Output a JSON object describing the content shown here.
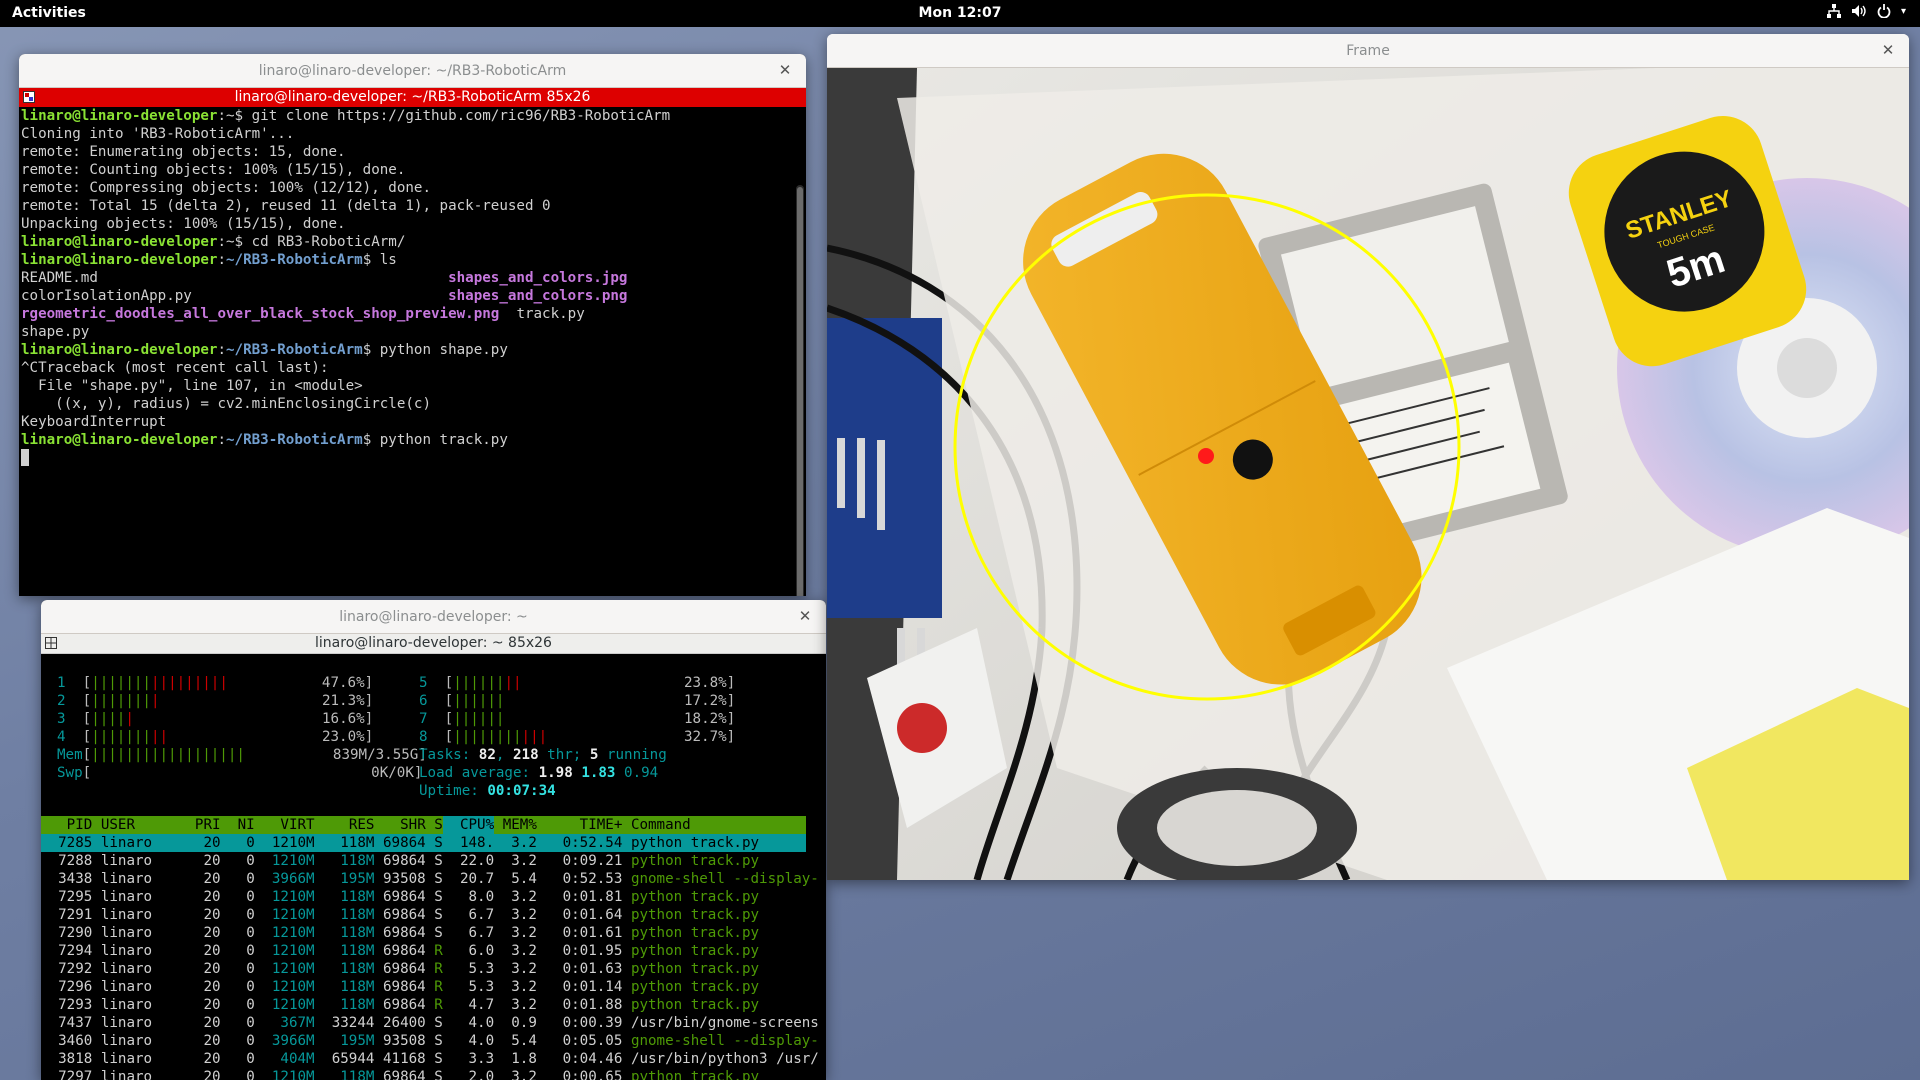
{
  "topbar": {
    "activities": "Activities",
    "clock": "Mon 12:07"
  },
  "terminal1": {
    "window_title": "linaro@linaro-developer: ~/RB3-RoboticArm",
    "tab_title": "linaro@linaro-developer: ~/RB3-RoboticArm 85x26",
    "prompt_user": "linaro@linaro-developer",
    "lines": {
      "l1_path": ":~$ ",
      "l1_cmd": "git clone https://github.com/ric96/RB3-RoboticArm",
      "l2": "Cloning into 'RB3-RoboticArm'...",
      "l3": "remote: Enumerating objects: 15, done.",
      "l4": "remote: Counting objects: 100% (15/15), done.",
      "l5": "remote: Compressing objects: 100% (12/12), done.",
      "l6": "remote: Total 15 (delta 2), reused 11 (delta 1), pack-reused 0",
      "l7": "Unpacking objects: 100% (15/15), done.",
      "l8_path": ":~$ ",
      "l8_cmd": "cd RB3-RoboticArm/",
      "l9_path": ":~/RB3-RoboticArm",
      "l9_cmd": "$ ls",
      "ls_col1": [
        "README.md",
        "colorIsolationApp.py",
        "rgeometric_doodles_all_over_black_stock_shop_preview.png",
        "shape.py"
      ],
      "ls_col2": [
        "shapes_and_colors.jpg",
        "shapes_and_colors.png",
        "track.py"
      ],
      "l14_path": ":~/RB3-RoboticArm",
      "l14_cmd": "$ python shape.py",
      "l15": "^CTraceback (most recent call last):",
      "l16": "  File \"shape.py\", line 107, in <module>",
      "l17": "    ((x, y), radius) = cv2.minEnclosingCircle(c)",
      "l18": "KeyboardInterrupt",
      "l19_path": ":~/RB3-RoboticArm",
      "l19_cmd": "$ python track.py"
    }
  },
  "terminal2": {
    "window_title": "linaro@linaro-developer: ~",
    "tab_title": "linaro@linaro-developer: ~ 85x26",
    "cpus": [
      {
        "id": "1",
        "bars_g": "|||||||",
        "bars_r": "|||||||||",
        "pct": "47.6%"
      },
      {
        "id": "2",
        "bars_g": "|||||||",
        "bars_r": "|",
        "pct": "21.3%"
      },
      {
        "id": "3",
        "bars_g": "||||",
        "bars_r": "|",
        "pct": "16.6%"
      },
      {
        "id": "4",
        "bars_g": "|||||||",
        "bars_r": "||",
        "pct": "23.0%"
      },
      {
        "id": "5",
        "bars_g": "||||||",
        "bars_r": "||",
        "pct": "23.8%"
      },
      {
        "id": "6",
        "bars_g": "||||||",
        "bars_r": "",
        "pct": "17.2%"
      },
      {
        "id": "7",
        "bars_g": "||||||",
        "bars_r": "",
        "pct": "18.2%"
      },
      {
        "id": "8",
        "bars_g": "||||||||",
        "bars_r": "|||",
        "pct": "32.7%"
      }
    ],
    "mem": {
      "label": "Mem",
      "bars": "||||||||||||||||||",
      "value": "839M/3.55G"
    },
    "swp": {
      "label": "Swp",
      "value": "0K/0K"
    },
    "tasks": {
      "label": "Tasks: ",
      "count": "82",
      "sep1": ", ",
      "thr": "218",
      "thr_label": " thr; ",
      "running": "5",
      "running_label": " running"
    },
    "load": {
      "label": "Load average: ",
      "v1": "1.98",
      "v2": "1.83",
      "v3": "0.94"
    },
    "uptime": {
      "label": "Uptime: ",
      "value": "00:07:34"
    },
    "header": {
      "pid": "  PID",
      "user": "USER",
      "pri": "PRI",
      "ni": "NI",
      "virt": "VIRT",
      "res": "RES",
      "shr": "SHR",
      "s": "S",
      "cpu": "CPU%",
      "mem": "MEM%",
      "time": "TIME+",
      "cmd": "Command"
    },
    "processes": [
      {
        "pid": "7285",
        "user": "linaro",
        "pri": "20",
        "ni": "0",
        "virt": "1210M",
        "res": "118M",
        "shr": "69864",
        "s": "S",
        "cpu": "148.",
        "mem": "3.2",
        "time": "0:52.54",
        "cmd": "python track.py"
      },
      {
        "pid": "7288",
        "user": "linaro",
        "pri": "20",
        "ni": "0",
        "virt": "1210M",
        "res": "118M",
        "shr": "69864",
        "s": "S",
        "cpu": "22.0",
        "mem": "3.2",
        "time": "0:09.21",
        "cmd": "python track.py"
      },
      {
        "pid": "3438",
        "user": "linaro",
        "pri": "20",
        "ni": "0",
        "virt": "3966M",
        "res": "195M",
        "shr": "93508",
        "s": "S",
        "cpu": "20.7",
        "mem": "5.4",
        "time": "0:52.53",
        "cmd": "gnome-shell --display-"
      },
      {
        "pid": "7295",
        "user": "linaro",
        "pri": "20",
        "ni": "0",
        "virt": "1210M",
        "res": "118M",
        "shr": "69864",
        "s": "S",
        "cpu": "8.0",
        "mem": "3.2",
        "time": "0:01.81",
        "cmd": "python track.py"
      },
      {
        "pid": "7291",
        "user": "linaro",
        "pri": "20",
        "ni": "0",
        "virt": "1210M",
        "res": "118M",
        "shr": "69864",
        "s": "S",
        "cpu": "6.7",
        "mem": "3.2",
        "time": "0:01.64",
        "cmd": "python track.py"
      },
      {
        "pid": "7290",
        "user": "linaro",
        "pri": "20",
        "ni": "0",
        "virt": "1210M",
        "res": "118M",
        "shr": "69864",
        "s": "S",
        "cpu": "6.7",
        "mem": "3.2",
        "time": "0:01.61",
        "cmd": "python track.py"
      },
      {
        "pid": "7294",
        "user": "linaro",
        "pri": "20",
        "ni": "0",
        "virt": "1210M",
        "res": "118M",
        "shr": "69864",
        "s": "R",
        "cpu": "6.0",
        "mem": "3.2",
        "time": "0:01.95",
        "cmd": "python track.py"
      },
      {
        "pid": "7292",
        "user": "linaro",
        "pri": "20",
        "ni": "0",
        "virt": "1210M",
        "res": "118M",
        "shr": "69864",
        "s": "R",
        "cpu": "5.3",
        "mem": "3.2",
        "time": "0:01.63",
        "cmd": "python track.py"
      },
      {
        "pid": "7296",
        "user": "linaro",
        "pri": "20",
        "ni": "0",
        "virt": "1210M",
        "res": "118M",
        "shr": "69864",
        "s": "R",
        "cpu": "5.3",
        "mem": "3.2",
        "time": "0:01.14",
        "cmd": "python track.py"
      },
      {
        "pid": "7293",
        "user": "linaro",
        "pri": "20",
        "ni": "0",
        "virt": "1210M",
        "res": "118M",
        "shr": "69864",
        "s": "R",
        "cpu": "4.7",
        "mem": "3.2",
        "time": "0:01.88",
        "cmd": "python track.py"
      },
      {
        "pid": "7437",
        "user": "linaro",
        "pri": "20",
        "ni": "0",
        "virt": "367M",
        "res": "33244",
        "shr": "26400",
        "s": "S",
        "cpu": "4.0",
        "mem": "0.9",
        "time": "0:00.39",
        "cmd": "/usr/bin/gnome-screens"
      },
      {
        "pid": "3460",
        "user": "linaro",
        "pri": "20",
        "ni": "0",
        "virt": "3966M",
        "res": "195M",
        "shr": "93508",
        "s": "S",
        "cpu": "4.0",
        "mem": "5.4",
        "time": "0:05.05",
        "cmd": "gnome-shell --display-"
      },
      {
        "pid": "3818",
        "user": "linaro",
        "pri": "20",
        "ni": "0",
        "virt": "404M",
        "res": "65944",
        "shr": "41168",
        "s": "S",
        "cpu": "3.3",
        "mem": "1.8",
        "time": "0:04.46",
        "cmd": "/usr/bin/python3 /usr/"
      },
      {
        "pid": "7297",
        "user": "linaro",
        "pri": "20",
        "ni": "0",
        "virt": "1210M",
        "res": "118M",
        "shr": "69864",
        "s": "S",
        "cpu": "2.0",
        "mem": "3.2",
        "time": "0:00.65",
        "cmd": "python track.py"
      }
    ]
  },
  "frame": {
    "window_title": "Frame",
    "detection": {
      "circle_color": "#ffff00",
      "center_color": "#ff0000"
    },
    "tape_brand": "STANLEY",
    "tape_sub": "TOUGH CASE",
    "tape_size": "5m"
  },
  "colors": {
    "terminal_tab_active": "#dd0000",
    "prompt_user": "#8ae234",
    "prompt_path": "#729fcf",
    "htop_header": "#4e9a06",
    "htop_selected": "#06989a"
  }
}
